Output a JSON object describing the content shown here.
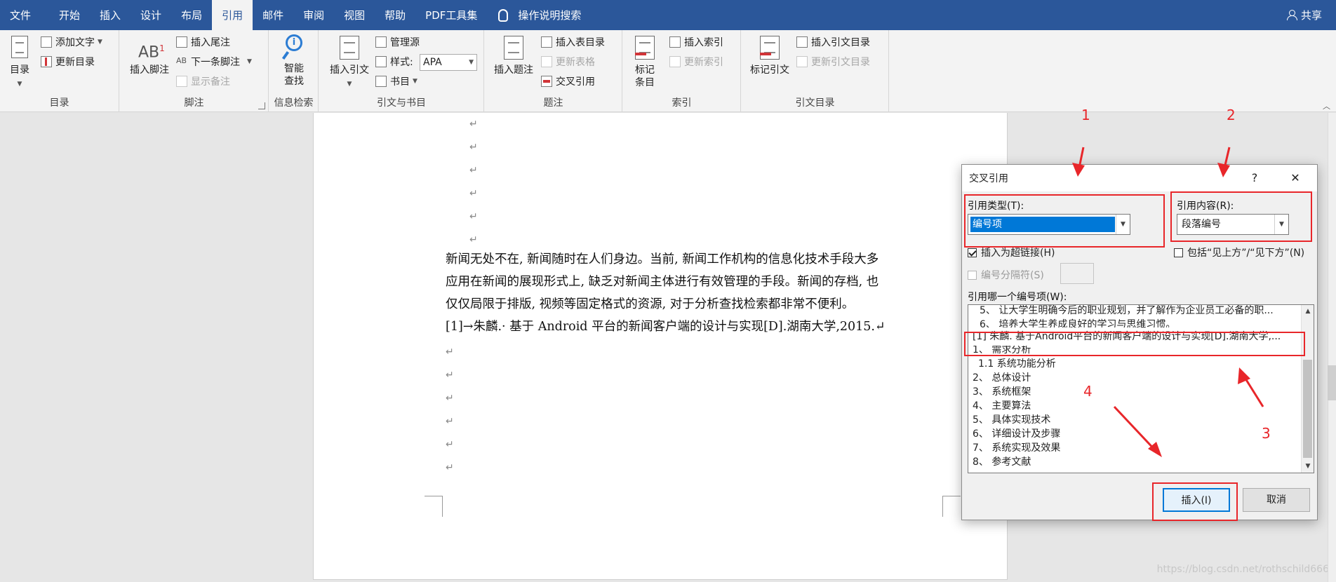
{
  "menu": {
    "tabs": [
      "文件",
      "开始",
      "插入",
      "设计",
      "布局",
      "引用",
      "邮件",
      "审阅",
      "视图",
      "帮助",
      "PDF工具集"
    ],
    "active_tab": "引用",
    "tell_me": "操作说明搜索",
    "share": "共享"
  },
  "ribbon": {
    "groups": {
      "toc": "目录",
      "footnotes": "脚注",
      "research": "信息检索",
      "citations": "引文与书目",
      "captions": "题注",
      "index": "索引",
      "toa": "引文目录"
    },
    "toc_button": "目录",
    "add_text": "添加文字",
    "update_toc": "更新目录",
    "insert_footnote": "插入脚注",
    "insert_endnote": "插入尾注",
    "next_footnote": "下一条脚注",
    "show_notes": "显示备注",
    "smart_lookup_1": "智能",
    "smart_lookup_2": "查找",
    "insert_citation": "插入引文",
    "manage_sources": "管理源",
    "style_label": "样式:",
    "style_value": "APA",
    "bibliography": "书目",
    "insert_caption": "插入题注",
    "insert_table_of_figures": "插入表目录",
    "update_table": "更新表格",
    "cross_reference": "交叉引用",
    "mark_entry_1": "标记",
    "mark_entry_2": "条目",
    "insert_index": "插入索引",
    "update_index": "更新索引",
    "mark_citation": "标记引文",
    "insert_toa": "插入引文目录",
    "update_toa": "更新引文目录"
  },
  "document": {
    "paragraph_mark": "↵",
    "lines": [
      "新闻无处不在, 新闻随时在人们身边。当前, 新闻工作机构的信息化技术手段大多",
      "应用在新闻的展现形式上, 缺乏对新闻主体进行有效管理的手段。新闻的存档, 也",
      "仅仅局限于排版, 视频等固定格式的资源, 对于分析查找检索都非常不便利。",
      "[1]→朱麟.· 基于 Android 平台的新闻客户端的设计与实现[D].湖南大学,2015.↵"
    ],
    "watermark": "https://blog.csdn.net/rothschild666"
  },
  "dialog": {
    "title": "交叉引用",
    "help": "?",
    "close": "✕",
    "ref_type_label": "引用类型(T):",
    "ref_type_value": "编号项",
    "ref_content_label": "引用内容(R):",
    "ref_content_value": "段落编号",
    "insert_as_hyperlink": "插入为超链接(H)",
    "include_above_below": "包括“见上方”/“见下方”(N)",
    "separate_numbers": "编号分隔符(S)",
    "for_which_label": "引用哪一个编号项(W):",
    "items": [
      "5、 让大学生明确今后的职业规划，并了解作为企业员工必备的职...",
      "6、 培养大学生养成良好的学习与思维习惯。",
      "[1] 朱麟. 基于Android平台的新闻客户端的设计与实现[D].湖南大学,...",
      "1、 需求分析",
      "1.1 系统功能分析",
      "2、 总体设计",
      "3、 系统框架",
      "4、 主要算法",
      "5、 具体实现技术",
      "6、 详细设计及步骤",
      "7、 系统实现及效果",
      "8、 参考文献"
    ],
    "insert_button": "插入(I)",
    "cancel_button": "取消"
  },
  "annotations": {
    "labels": [
      "1",
      "2",
      "3",
      "4"
    ],
    "color": "#e8262a"
  }
}
